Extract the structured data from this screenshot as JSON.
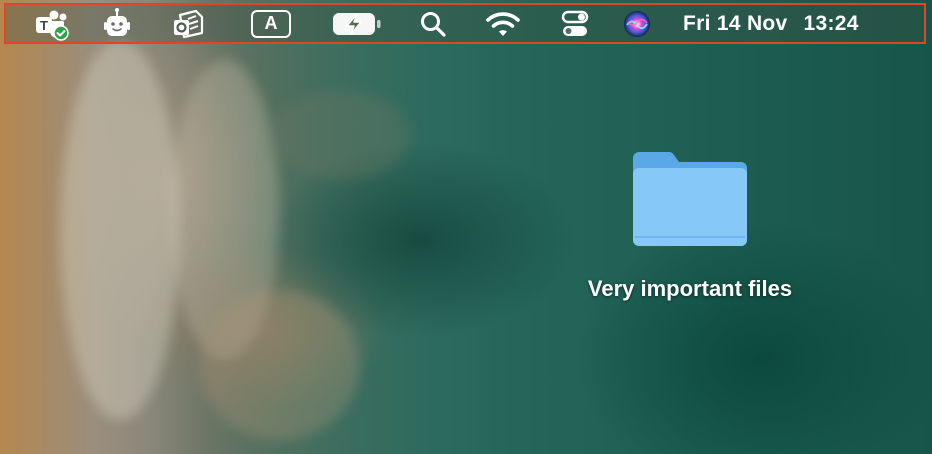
{
  "menubar": {
    "icons": [
      "teams-icon",
      "robot-assistant-icon",
      "outlook-icon",
      "input-source-icon",
      "battery-charging-icon",
      "spotlight-search-icon",
      "wifi-icon",
      "control-center-icon",
      "siri-icon"
    ],
    "input_source_letter": "A",
    "clock": {
      "date": "Fri 14 Nov",
      "time": "13:24"
    },
    "highlight_color": "#e0452b"
  },
  "desktop": {
    "wallpaper": "aerial ocean beach",
    "folder": {
      "label": "Very important files",
      "icon": "folder-icon",
      "color": "#7cc3f5"
    }
  }
}
